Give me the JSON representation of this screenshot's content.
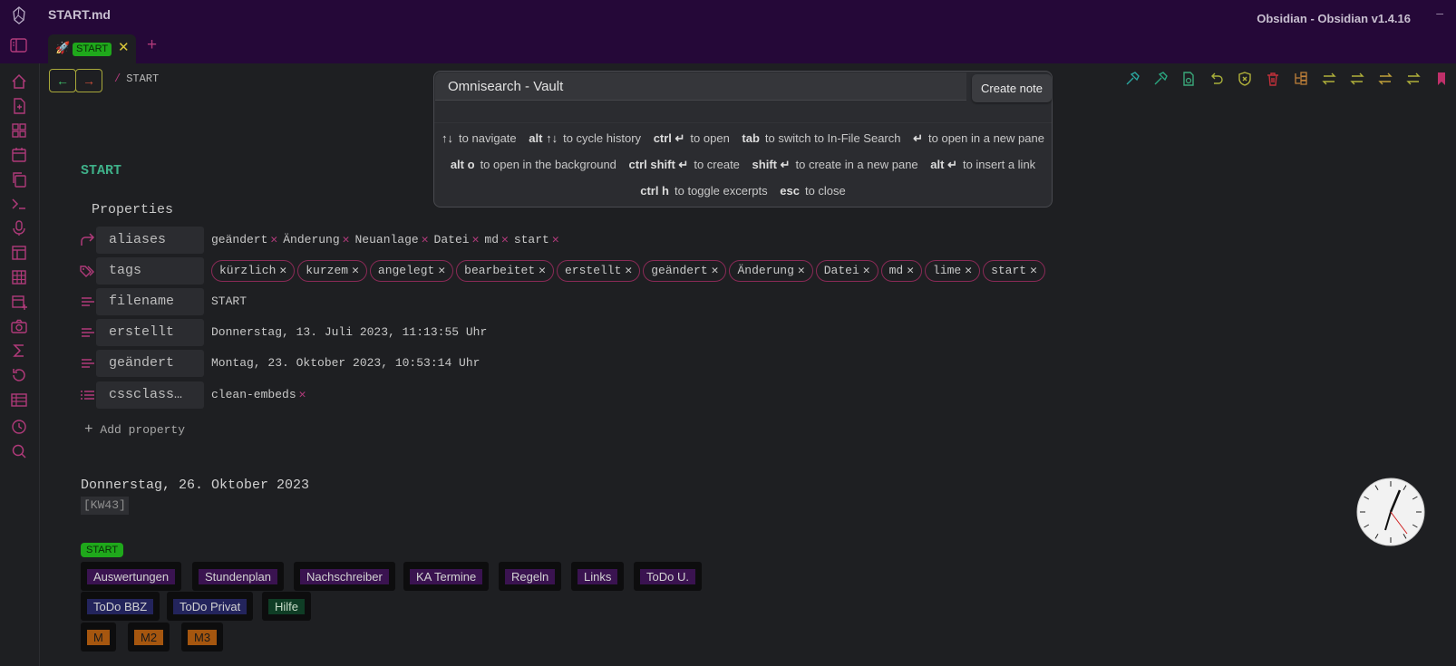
{
  "window": {
    "file_name": "START.md",
    "app_title": "Obsidian - Obsidian v1.4.16",
    "minimize_label": "–"
  },
  "tabs": [
    {
      "label": "START",
      "close": "✕"
    }
  ],
  "new_tab_label": "+",
  "nav": {
    "back": "←",
    "forward": "→",
    "breadcrumb_sep": "/",
    "breadcrumb": "START"
  },
  "note": {
    "title": "START",
    "properties_heading": "Properties",
    "properties": {
      "aliases": {
        "key": "aliases",
        "values": [
          "geändert",
          "Änderung",
          "Neuanlage",
          "Datei",
          "md",
          "start"
        ]
      },
      "tags": {
        "key": "tags",
        "values": [
          "kürzlich",
          "kurzem",
          "angelegt",
          "bearbeitet",
          "erstellt",
          "geändert",
          "Änderung",
          "Datei",
          "md",
          "lime",
          "start"
        ]
      },
      "filename": {
        "key": "filename",
        "value": "START"
      },
      "erstellt": {
        "key": "erstellt",
        "value": "Donnerstag, 13. Juli 2023, 11:13:55 Uhr"
      },
      "geaendert": {
        "key": "geändert",
        "value": "Montag, 23. Oktober 2023, 10:53:14 Uhr"
      },
      "cssclasses": {
        "key": "cssclass…",
        "values": [
          "clean-embeds"
        ]
      }
    },
    "add_property": "Add property",
    "date_heading": "Donnerstag, 26. Oktober 2023",
    "week": "[KW43]",
    "start_badge": "START",
    "link_buttons": {
      "row1": [
        "Auswertungen",
        "Stundenplan",
        "Nachschreiber",
        "KA Termine",
        "Regeln",
        "Links",
        "ToDo U."
      ],
      "row2": [
        "ToDo BBZ",
        "ToDo Privat",
        "Hilfe"
      ],
      "row3": [
        "M",
        "M2",
        "M3"
      ]
    }
  },
  "omnisearch": {
    "query": "Omnisearch - Vault",
    "create_note": "Create note",
    "hints_row1": [
      {
        "key": "↑↓",
        "text": "to navigate"
      },
      {
        "key": "alt ↑↓",
        "text": "to cycle history"
      },
      {
        "key": "ctrl ↵",
        "text": "to open"
      },
      {
        "key": "tab",
        "text": "to switch to In-File Search"
      },
      {
        "key": "↵",
        "text": "to open in a new pane"
      }
    ],
    "hints_row2": [
      {
        "key": "alt o",
        "text": "to open in the background"
      },
      {
        "key": "ctrl shift ↵",
        "text": "to create"
      },
      {
        "key": "shift ↵",
        "text": "to create in a new pane"
      },
      {
        "key": "alt ↵",
        "text": "to insert a link"
      }
    ],
    "hints_row3": [
      {
        "key": "ctrl h",
        "text": "to toggle excerpts"
      },
      {
        "key": "esc",
        "text": "to close"
      }
    ]
  },
  "colors": {
    "titlebar_bg": "#250838",
    "accent_pink": "#b03a7a",
    "accent_green": "#1fa81b",
    "heading_teal": "#3fb089"
  }
}
